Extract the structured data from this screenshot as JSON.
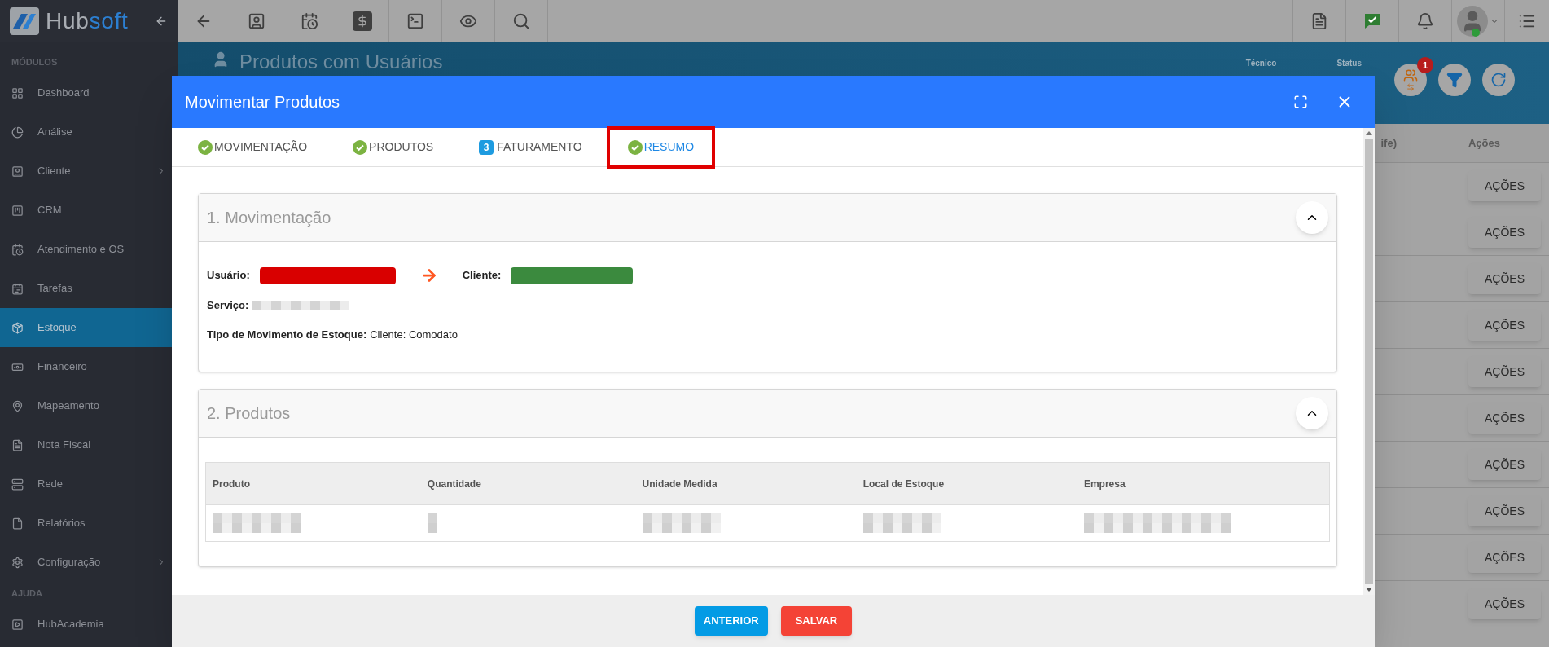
{
  "logo": {
    "text_1": "Hub",
    "text_2": "soft"
  },
  "sidebar": {
    "sections": [
      {
        "title": "MÓDULOS",
        "items": [
          {
            "label": "Dashboard",
            "selected": false,
            "submenu": false
          },
          {
            "label": "Análise",
            "selected": false,
            "submenu": false
          },
          {
            "label": "Cliente",
            "selected": false,
            "submenu": true
          },
          {
            "label": "CRM",
            "selected": false,
            "submenu": false
          },
          {
            "label": "Atendimento e OS",
            "selected": false,
            "submenu": false
          },
          {
            "label": "Tarefas",
            "selected": false,
            "submenu": false
          },
          {
            "label": "Estoque",
            "selected": true,
            "submenu": false
          },
          {
            "label": "Financeiro",
            "selected": false,
            "submenu": false
          },
          {
            "label": "Mapeamento",
            "selected": false,
            "submenu": false
          },
          {
            "label": "Nota Fiscal",
            "selected": false,
            "submenu": false
          },
          {
            "label": "Rede",
            "selected": false,
            "submenu": false
          },
          {
            "label": "Relatórios",
            "selected": false,
            "submenu": false
          },
          {
            "label": "Configuração",
            "selected": false,
            "submenu": true
          }
        ]
      },
      {
        "title": "AJUDA",
        "items": [
          {
            "label": "HubAcademia",
            "selected": false,
            "submenu": false
          }
        ]
      }
    ]
  },
  "page": {
    "title": "Produtos com Usuários",
    "filters": [
      "Técnico",
      "Status"
    ],
    "badge": "1",
    "table": {
      "columns": [
        "ife)",
        "Ações"
      ],
      "rows": [
        {
          "action": "AÇÕES"
        },
        {
          "action": "AÇÕES"
        },
        {
          "action": "AÇÕES"
        },
        {
          "action": "AÇÕES"
        },
        {
          "action": "AÇÕES"
        },
        {
          "action": "AÇÕES"
        },
        {
          "action": "AÇÕES"
        },
        {
          "action": "AÇÕES"
        },
        {
          "action": "AÇÕES"
        },
        {
          "action": "AÇÕES"
        }
      ]
    }
  },
  "modal": {
    "title": "Movimentar Produtos",
    "tabs": [
      {
        "label": "MOVIMENTAÇÃO",
        "kind": "check",
        "selected": false,
        "highlighted": false
      },
      {
        "label": "PRODUTOS",
        "kind": "check",
        "selected": false,
        "highlighted": false
      },
      {
        "label": "FATURAMENTO",
        "kind": "step",
        "step": "3",
        "selected": false,
        "highlighted": false
      },
      {
        "label": "RESUMO",
        "kind": "check",
        "selected": true,
        "highlighted": true
      }
    ],
    "movimentacao": {
      "title": "1. Movimentação",
      "expanded": true,
      "parties": [
        {
          "label": "Usuário:",
          "color": "#d90000"
        },
        {
          "label": "Cliente:",
          "color": "#3b8a3e"
        }
      ],
      "service_label": "Serviço:",
      "type_label": "Tipo de Movimento de Estoque:",
      "type_value": "Cliente: Comodato"
    },
    "produtos": {
      "title": "2. Produtos",
      "expanded": true,
      "columns": [
        "Produto",
        "Quantidade",
        "Unidade Medida",
        "Local de Estoque",
        "Empresa"
      ]
    },
    "buttons": [
      {
        "label": "ANTERIOR",
        "kind": "secondary"
      },
      {
        "label": "SALVAR",
        "kind": "primary"
      }
    ]
  }
}
